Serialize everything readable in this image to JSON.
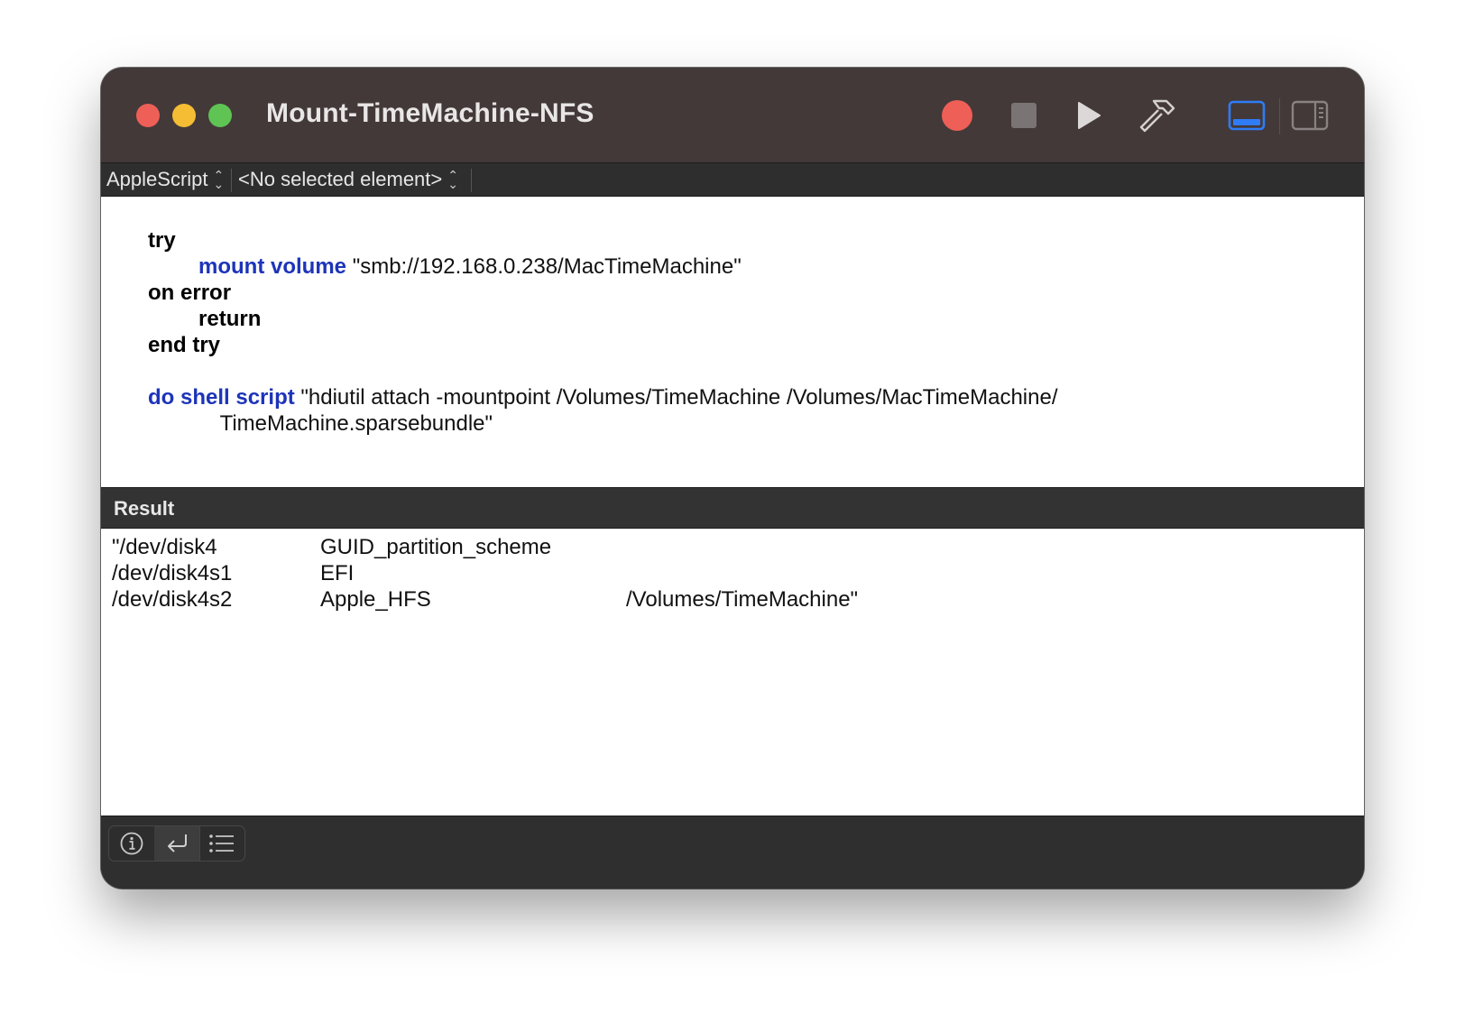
{
  "window": {
    "title": "Mount-TimeMachine-NFS"
  },
  "toolbar": {
    "record_icon": "record-icon",
    "stop_icon": "stop-icon",
    "run_icon": "run-icon",
    "compile_icon": "hammer-icon",
    "bottom_view_icon": "show-bottom-pane-icon",
    "side_view_icon": "show-sidebar-icon",
    "accent_color": "#2f7cf6",
    "record_color": "#ee5f57"
  },
  "navbar": {
    "language": "AppleScript",
    "element": "<No selected element>"
  },
  "editor": {
    "line1_kw": "try",
    "line2_cmd": "mount volume",
    "line2_str": " \"smb://192.168.0.238/MacTimeMachine\"",
    "line3_kw": "on error",
    "line4_kw": "return",
    "line5_kw": "end try",
    "line7_cmd": "do shell script",
    "line7_str": " \"hdiutil attach -mountpoint /Volumes/TimeMachine /Volumes/MacTimeMachine/",
    "line8_str": "TimeMachine.sparsebundle\"",
    "command_color": "#1d34b9"
  },
  "result": {
    "label": "Result",
    "rows": [
      [
        "\"/dev/disk4",
        "GUID_partition_scheme",
        ""
      ],
      [
        "/dev/disk4s1",
        "EFI",
        ""
      ],
      [
        "/dev/disk4s2",
        "Apple_HFS",
        "/Volumes/TimeMachine\""
      ]
    ]
  },
  "bottombar": {
    "info_icon": "info-icon",
    "reply_icon": "reply-icon",
    "list_icon": "list-icon"
  }
}
